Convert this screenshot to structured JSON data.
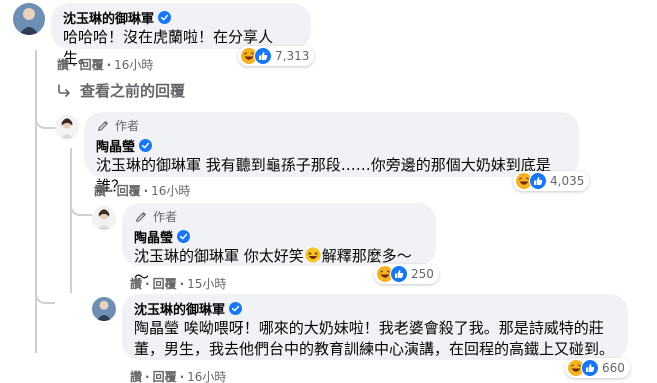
{
  "comments": [
    {
      "name": "沈玉琳的御琳軍",
      "text": "哈哈哈！沒在虎蘭啦！在分享人生。",
      "actions": {
        "like": "讚",
        "reply": "回覆",
        "time": "16小時"
      },
      "reactions": [
        "laugh",
        "like"
      ],
      "reaction_count": "7,313"
    },
    {
      "author_badge": "作者",
      "name": "陶晶瑩",
      "mention": "沈玉琳的御琳軍",
      "text": " 我有聽到龜孫子那段……你旁邊的那個大奶妹到底是誰？",
      "actions": {
        "like": "讚",
        "reply": "回覆",
        "time": "16小時"
      },
      "reactions": [
        "laugh",
        "like"
      ],
      "reaction_count": "4,035"
    },
    {
      "author_badge": "作者",
      "name": "陶晶瑩",
      "mention": "沈玉琳的御琳軍",
      "text_before_emoji": " 你太好笑",
      "text_after_emoji": "解釋那麼多～～",
      "actions": {
        "like": "讚",
        "reply": "回覆",
        "time": "15小時"
      },
      "reactions": [
        "laugh",
        "like"
      ],
      "reaction_count": "250"
    },
    {
      "name": "沈玉琳的御琳軍",
      "mention": "陶晶瑩",
      "line1": " 唉呦喂呀！哪來的大奶妹啦！我老婆會殺了我。那是詩威特的莊",
      "line2": "董，男生，我去他們台中的教育訓練中心演講，在回程的高鐵上又碰到。",
      "actions": {
        "like": "讚",
        "reply": "回覆",
        "time": "16小時"
      },
      "reactions": [
        "laugh",
        "like"
      ],
      "reaction_count": "660"
    }
  ],
  "view_previous": "查看之前的回覆",
  "dot": "·",
  "colors": {
    "verified": "#1877f2",
    "like": "#1877f2",
    "laugh": "#f7b125",
    "bubble": "#f0f2f5",
    "meta": "#65676b"
  }
}
